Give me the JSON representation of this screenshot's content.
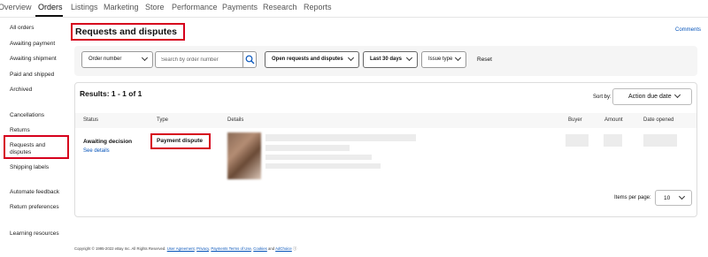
{
  "top_nav": {
    "tabs": [
      {
        "label": "Overview"
      },
      {
        "label": "Orders"
      },
      {
        "label": "Listings"
      },
      {
        "label": "Marketing"
      },
      {
        "label": "Store"
      },
      {
        "label": "Performance"
      },
      {
        "label": "Payments"
      },
      {
        "label": "Research"
      },
      {
        "label": "Reports"
      }
    ],
    "active": "Orders"
  },
  "sidebar": {
    "items": [
      {
        "label": "All orders"
      },
      {
        "label": "Awaiting payment"
      },
      {
        "label": "Awaiting shipment"
      },
      {
        "label": "Paid and shipped"
      },
      {
        "label": "Archived"
      },
      {
        "label": "Cancellations"
      },
      {
        "label": "Returns"
      },
      {
        "label": "Requests and"
      },
      {
        "label": "disputes"
      },
      {
        "label": "Shipping labels"
      },
      {
        "label": "Automate feedback"
      },
      {
        "label": "Return preferences"
      },
      {
        "label": "Learning resources"
      }
    ],
    "selected": "Requests and disputes"
  },
  "page": {
    "title": "Requests and disputes",
    "comments_link": "Comments"
  },
  "filters": {
    "search_by": "Order number",
    "search_placeholder": "Search by order number",
    "status_filter": "Open requests and disputes",
    "date_filter": "Last 30 days",
    "issue_type": "Issue type",
    "reset": "Reset"
  },
  "results": {
    "title": "Results: 1 - 1 of 1",
    "sort_label": "Sort by:",
    "sort_value": "Action due date",
    "columns": [
      "Status",
      "Type",
      "Details",
      "Buyer",
      "Amount",
      "Date opened"
    ],
    "rows": [
      {
        "status": "Awaiting decision",
        "see_details": "See details",
        "type": "Payment dispute"
      }
    ],
    "items_per_page_label": "Items per page:",
    "items_per_page_value": "10"
  },
  "footer": {
    "copyright": "Copyright © 1995-2022 eBay Inc. All Rights Reserved.",
    "links": [
      "User Agreement",
      "Privacy",
      "Payments Terms of Use",
      "Cookies",
      "AdChoice"
    ],
    "sep_comma": ",",
    "sep_and": "and"
  },
  "colors": {
    "highlight": "#d6001c",
    "link": "#0654ba"
  }
}
